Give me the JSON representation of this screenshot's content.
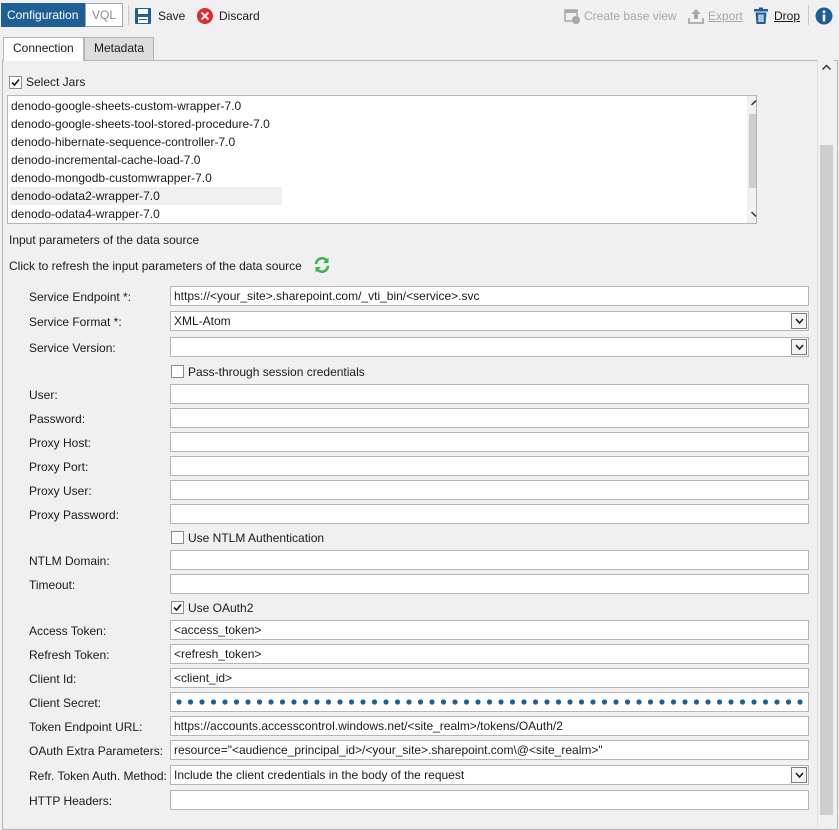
{
  "toolbar": {
    "configuration": "Configuration",
    "vql": "VQL",
    "save": "Save",
    "discard": "Discard",
    "create_base_view": "Create base view",
    "export": "Export",
    "drop": "Drop"
  },
  "tabs": {
    "connection": "Connection",
    "metadata": "Metadata"
  },
  "select_jars": {
    "label": "Select Jars",
    "checked": true
  },
  "jars": [
    "denodo-google-sheets-custom-wrapper-7.0",
    "denodo-google-sheets-tool-stored-procedure-7.0",
    "denodo-hibernate-sequence-controller-7.0",
    "denodo-incremental-cache-load-7.0",
    "denodo-mongodb-customwrapper-7.0",
    "denodo-odata2-wrapper-7.0",
    "denodo-odata4-wrapper-7.0"
  ],
  "selected_jar": "denodo-odata2-wrapper-7.0",
  "input_params_title": "Input parameters of the data source",
  "refresh_text": "Click to refresh the input parameters of the data source",
  "form": {
    "service_endpoint": {
      "label": "Service Endpoint *:",
      "value": "https://<your_site>.sharepoint.com/_vti_bin/<service>.svc"
    },
    "service_format": {
      "label": "Service Format *:",
      "value": "XML-Atom"
    },
    "service_version": {
      "label": "Service Version:",
      "value": ""
    },
    "pass_through": {
      "label": "Pass-through session credentials",
      "checked": false
    },
    "user": {
      "label": "User:",
      "value": ""
    },
    "password": {
      "label": "Password:",
      "value": ""
    },
    "proxy_host": {
      "label": "Proxy Host:",
      "value": ""
    },
    "proxy_port": {
      "label": "Proxy Port:",
      "value": ""
    },
    "proxy_user": {
      "label": "Proxy User:",
      "value": ""
    },
    "proxy_password": {
      "label": "Proxy Password:",
      "value": ""
    },
    "use_ntlm": {
      "label": "Use NTLM Authentication",
      "checked": false
    },
    "ntlm_domain": {
      "label": "NTLM Domain:",
      "value": ""
    },
    "timeout": {
      "label": "Timeout:",
      "value": ""
    },
    "use_oauth2": {
      "label": "Use OAuth2",
      "checked": true
    },
    "access_token": {
      "label": "Access Token:",
      "value": "<access_token>"
    },
    "refresh_token": {
      "label": "Refresh Token:",
      "value": "<refresh_token>"
    },
    "client_id": {
      "label": "Client Id:",
      "value": "<client_id>"
    },
    "client_secret": {
      "label": "Client Secret:",
      "masked": true
    },
    "token_endpoint_url": {
      "label": "Token Endpoint URL:",
      "value": "https://accounts.accesscontrol.windows.net/<site_realm>/tokens/OAuth/2"
    },
    "oauth_extra_params": {
      "label": "OAuth Extra Parameters:",
      "value": "resource=\"<audience_principal_id>/<your_site>.sharepoint.com\\@<site_realm>\""
    },
    "refr_token_auth_method": {
      "label": "Refr. Token Auth. Method:",
      "value": "Include the client credentials in the body of the request"
    },
    "http_headers": {
      "label": "HTTP Headers:",
      "value": ""
    }
  },
  "colors": {
    "accent": "#1f5f96",
    "save_icon": "#1f5f96",
    "discard_icon": "#e0282e",
    "refresh_icon": "#3cb44b",
    "info_icon": "#1f5f96",
    "password_dots": "#1f5f96"
  },
  "icons": [
    "save-icon",
    "discard-icon",
    "create-base-view-icon",
    "export-icon",
    "drop-icon",
    "info-icon",
    "refresh-icon",
    "checkbox-check-icon",
    "chevron-down-icon"
  ]
}
